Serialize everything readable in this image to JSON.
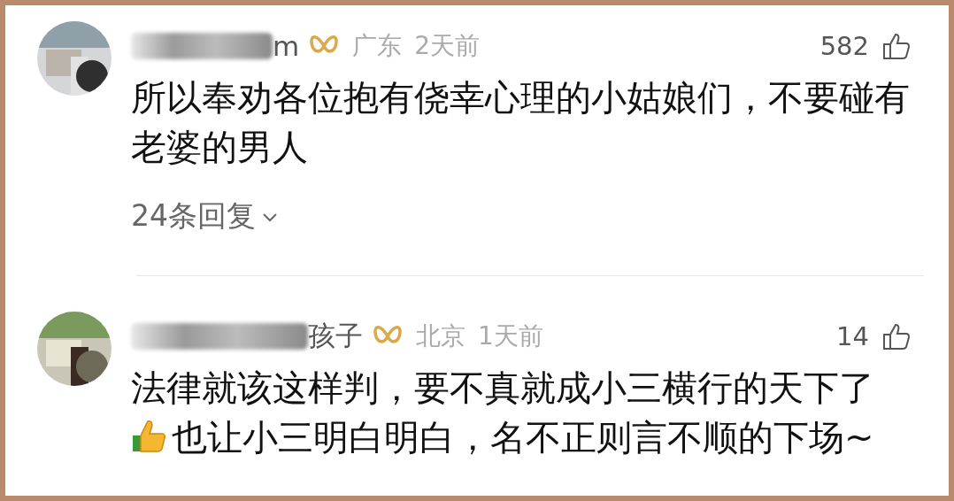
{
  "comments": [
    {
      "name_visible": "m",
      "location": "广东",
      "time": "2天前",
      "likes": "582",
      "lines": [
        {
          "text": "所以奉劝各位抱有侥幸心理的小姑娘们，不要碰有",
          "lead_emoji": false
        },
        {
          "text": "老婆的男人",
          "lead_emoji": false
        }
      ],
      "replies": "24条回复"
    },
    {
      "name_visible": "孩子",
      "location": "北京",
      "time": "1天前",
      "likes": "14",
      "lines": [
        {
          "text": "法律就该这样判，要不真就成小三横行的天下了",
          "lead_emoji": false
        },
        {
          "text": "也让小三明白明白，名不正则言不顺的下场~",
          "lead_emoji": true
        }
      ]
    }
  ]
}
